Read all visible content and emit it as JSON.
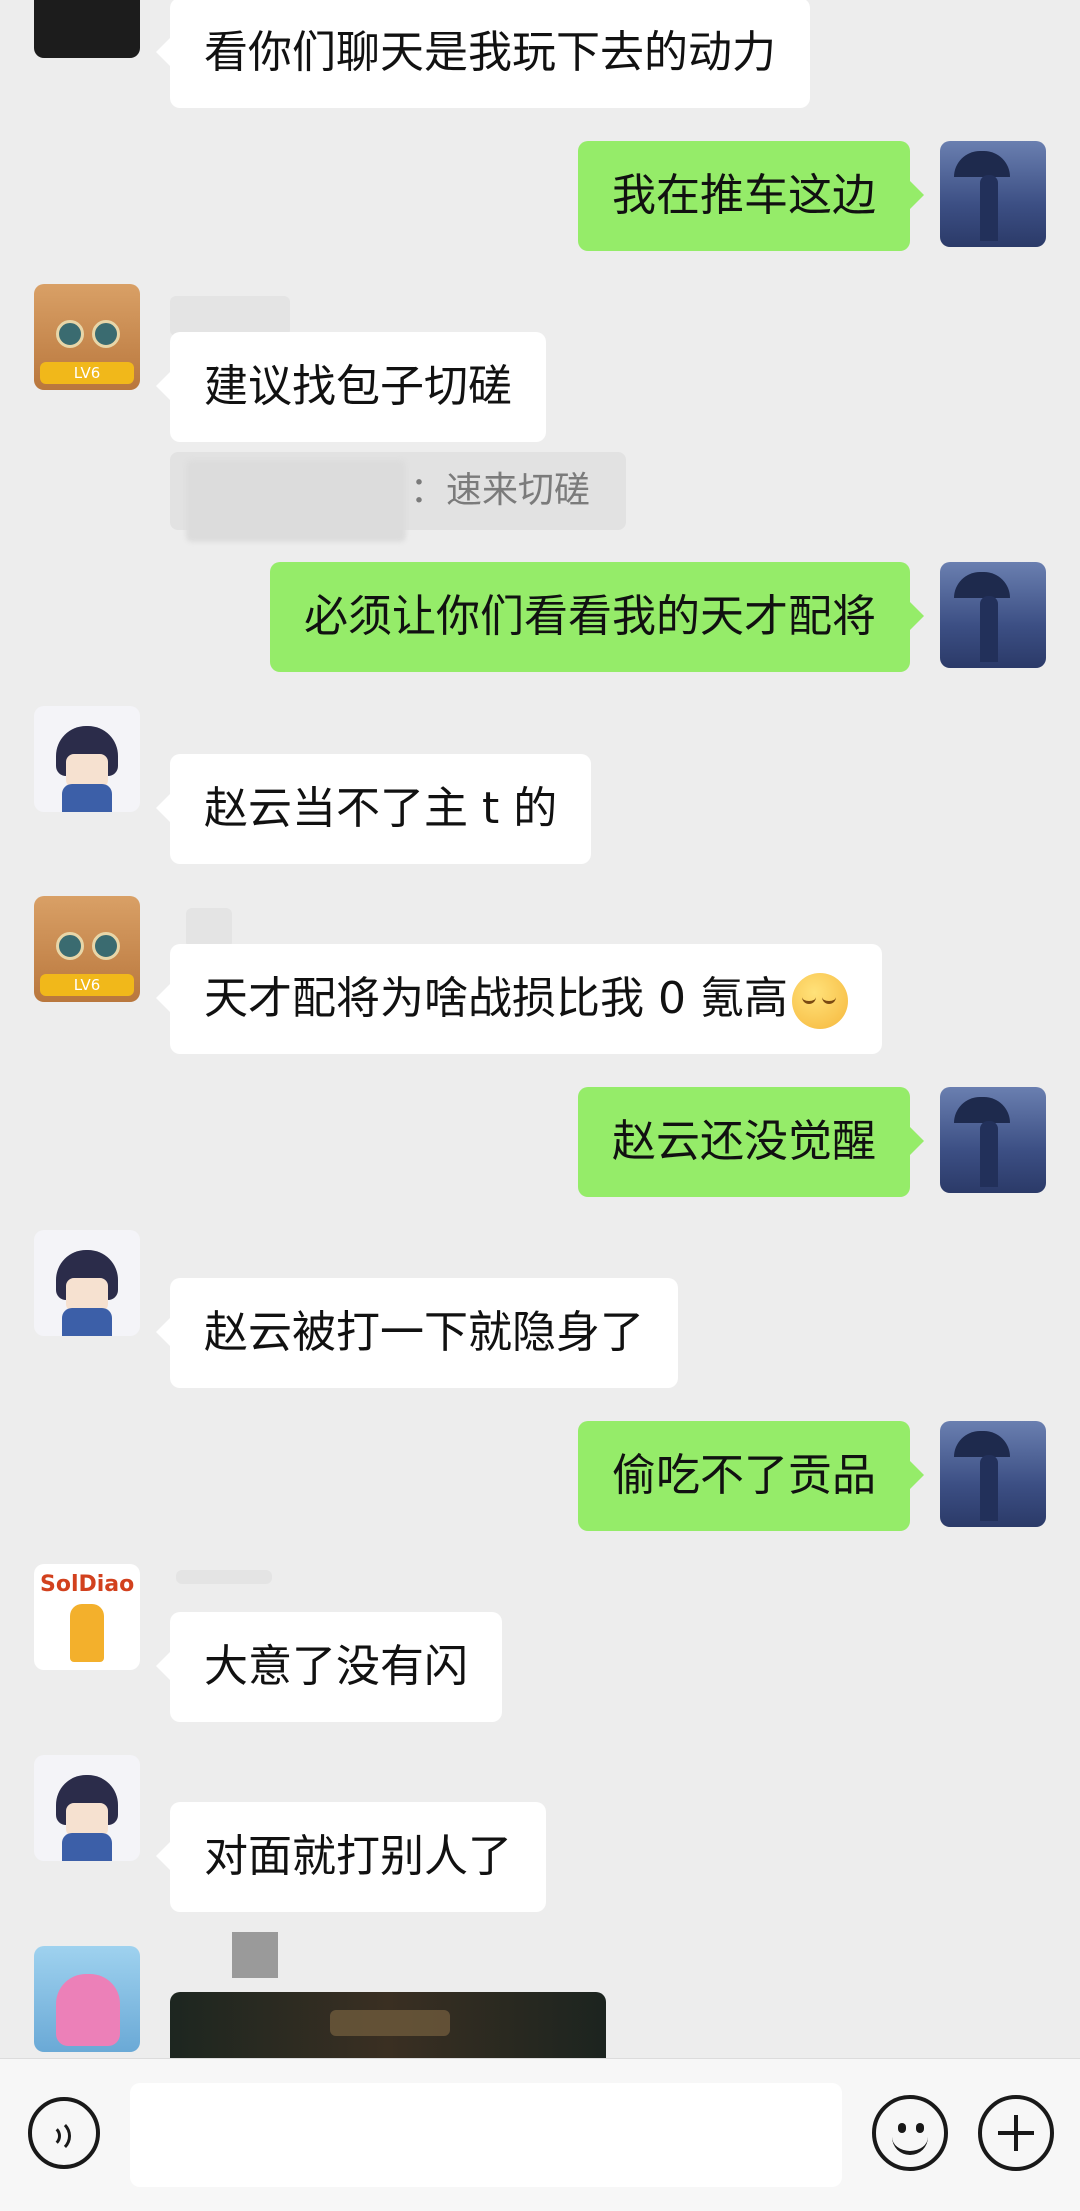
{
  "messages": {
    "m1": "看你们聊天是我玩下去的动力",
    "m2": "我在推车这边",
    "m3": "建议找包子切磋",
    "m3_quote": "：速来切磋",
    "m4": "必须让你们看看我的天才配将",
    "m5": "赵云当不了主 t 的",
    "m6": "天才配将为啥战损比我 0 氪高",
    "m7": "赵云还没觉醒",
    "m8": "赵云被打一下就隐身了",
    "m9": "偷吃不了贡品",
    "m10": "大意了没有闪",
    "m11": "对面就打别人了"
  },
  "avatars": {
    "cat_badge": "LV6",
    "soldiao_text": "SolDiao"
  },
  "icons": {
    "voice": "voice-icon",
    "emoji": "emoji-icon",
    "plus": "plus-icon",
    "smirk": "smirk-emoji-icon"
  },
  "colors": {
    "background": "#ededed",
    "bubble_out": "#95ec69",
    "bubble_in": "#ffffff"
  }
}
